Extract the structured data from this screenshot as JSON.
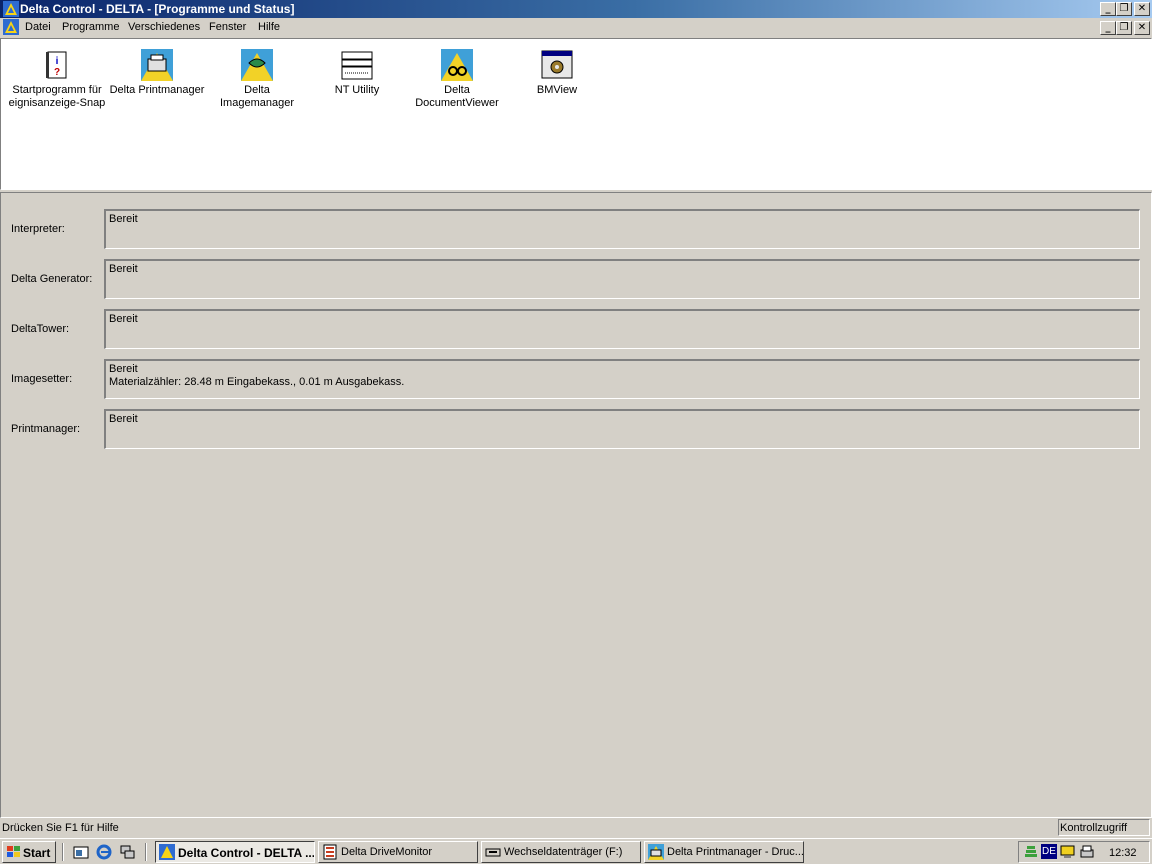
{
  "window": {
    "title": "Delta Control - DELTA - [Programme und Status]"
  },
  "menu": {
    "items": [
      "Datei",
      "Programme",
      "Verschiedenes",
      "Fenster",
      "Hilfe"
    ]
  },
  "programs": [
    {
      "label": "Startprogramm für\neignisanzeige-Snap",
      "icon": "info-book-icon"
    },
    {
      "label": "Delta Printmanager",
      "icon": "printmanager-icon"
    },
    {
      "label": "Delta\nImagemanager",
      "icon": "imagemanager-icon"
    },
    {
      "label": "NT Utility",
      "icon": "nt-utility-icon"
    },
    {
      "label": "Delta\nDocumentViewer",
      "icon": "documentviewer-icon"
    },
    {
      "label": "BMView",
      "icon": "bmview-icon"
    }
  ],
  "status": {
    "rows": [
      {
        "label": "Interpreter:",
        "value": "Bereit"
      },
      {
        "label": "Delta Generator:",
        "value": "Bereit"
      },
      {
        "label": "DeltaTower:",
        "value": "Bereit"
      },
      {
        "label": "Imagesetter:",
        "value": "Bereit\nMaterialzähler: 28.48 m Eingabekass., 0.01 m Ausgabekass."
      },
      {
        "label": "Printmanager:",
        "value": "Bereit"
      }
    ]
  },
  "statusbar": {
    "hint": "Drücken Sie F1 für Hilfe",
    "pane": "Kontrollzugriff"
  },
  "taskbar": {
    "start": "Start",
    "buttons": [
      {
        "label": "Delta Control - DELTA ...",
        "active": true
      },
      {
        "label": "Delta DriveMonitor",
        "active": false
      },
      {
        "label": "Wechseldatenträger (F:)",
        "active": false
      },
      {
        "label": "Delta Printmanager - Druc...",
        "active": false
      }
    ],
    "tray_lang": "DE",
    "clock": "12:32"
  },
  "colors": {
    "titlebar_start": "#0a246a",
    "face": "#d4d0c8",
    "panel": "#ffffff"
  }
}
